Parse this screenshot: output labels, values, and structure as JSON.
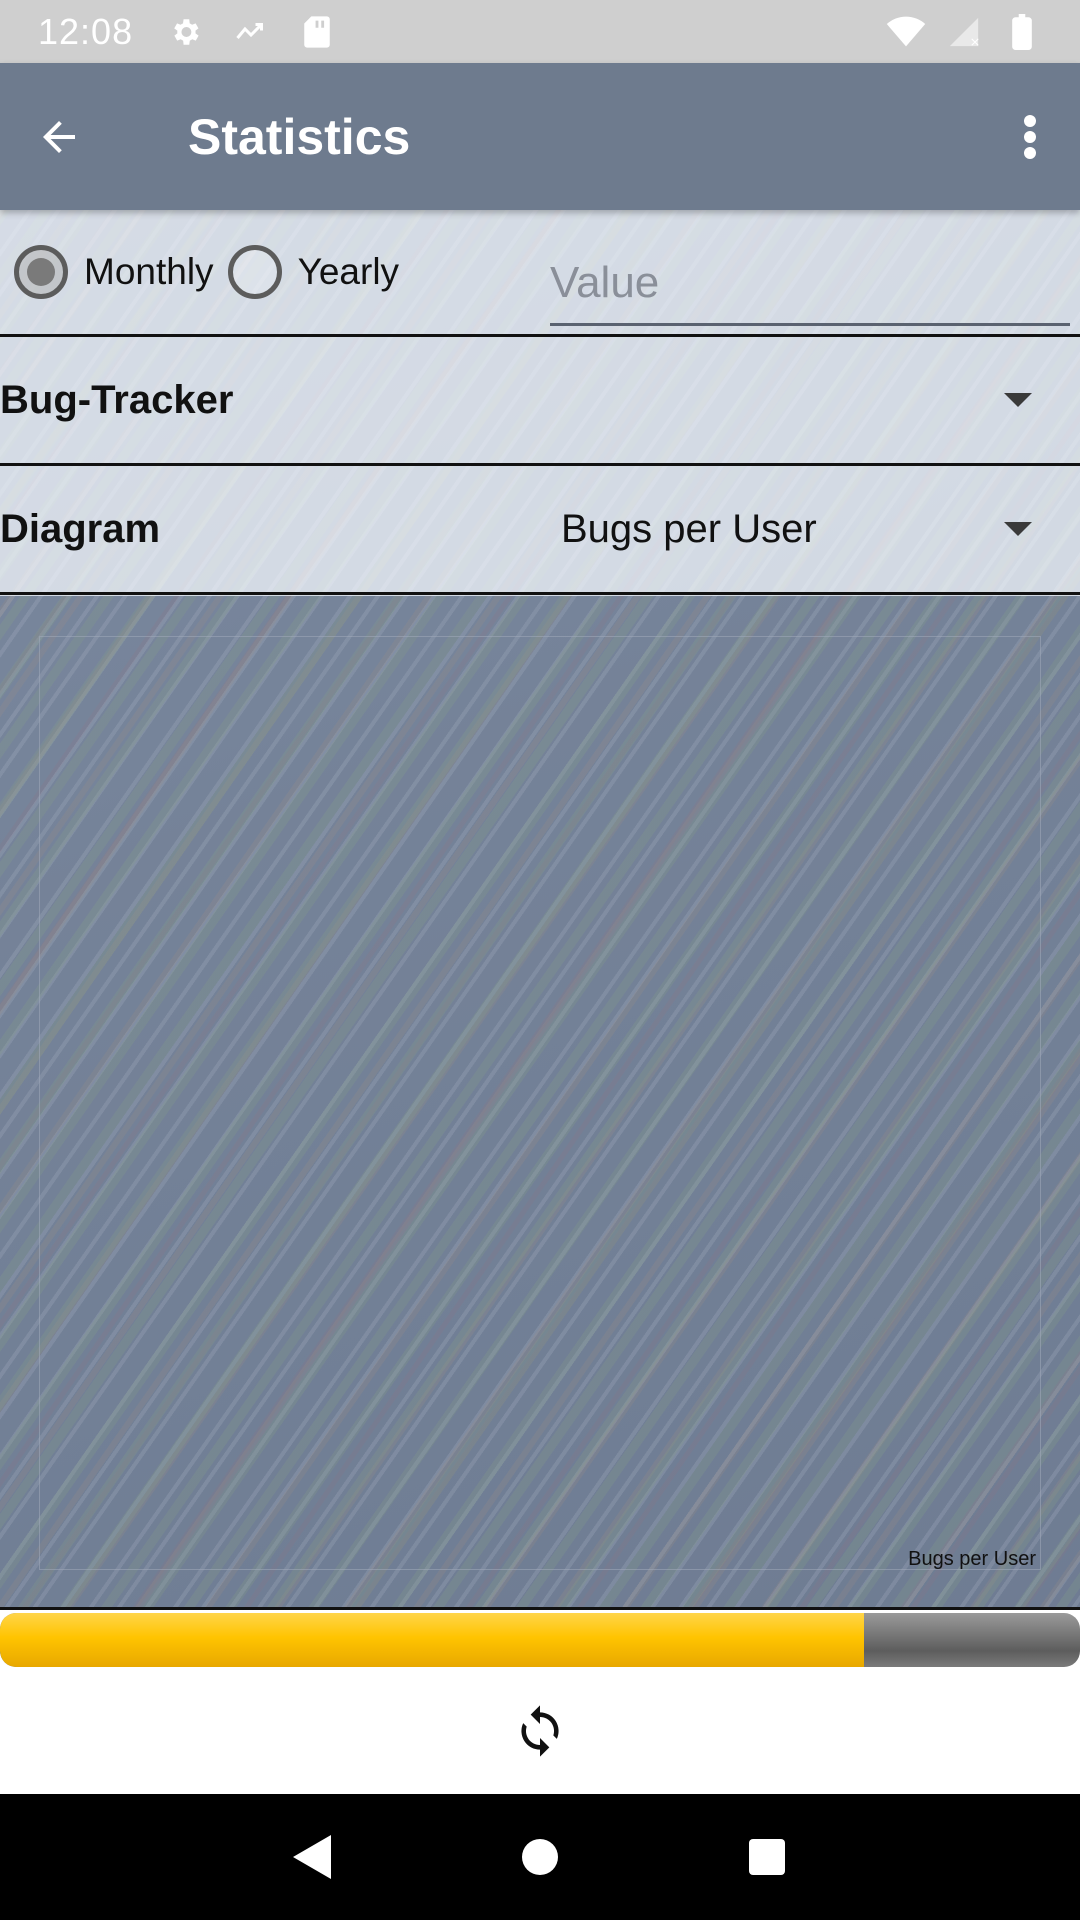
{
  "status_bar": {
    "time": "12:08",
    "icons_left": [
      "settings-icon",
      "trend-icon",
      "sd-card-icon"
    ],
    "icons_right": [
      "wifi-icon",
      "cell-signal-icon",
      "battery-icon"
    ]
  },
  "app_bar": {
    "title": "Statistics",
    "back_icon": "arrow-back-icon",
    "menu_icon": "more-vert-icon",
    "background_color": "#6e7b8e"
  },
  "period": {
    "options": [
      {
        "label": "Monthly",
        "selected": true
      },
      {
        "label": "Yearly",
        "selected": false
      }
    ],
    "value_placeholder": "Value",
    "value": ""
  },
  "tracker_spinner": {
    "label": "Bug-Tracker",
    "selected": ""
  },
  "diagram_spinner": {
    "label": "Diagram",
    "selected": "Bugs per User"
  },
  "chart": {
    "description": "Bugs per User"
  },
  "progress": {
    "fraction": 0.8,
    "fill_color": "#ffc400"
  },
  "actions": {
    "refresh_icon": "refresh-icon"
  },
  "nav_bar": {
    "buttons": [
      "back-triangle-icon",
      "home-circle-icon",
      "recents-square-icon"
    ]
  }
}
